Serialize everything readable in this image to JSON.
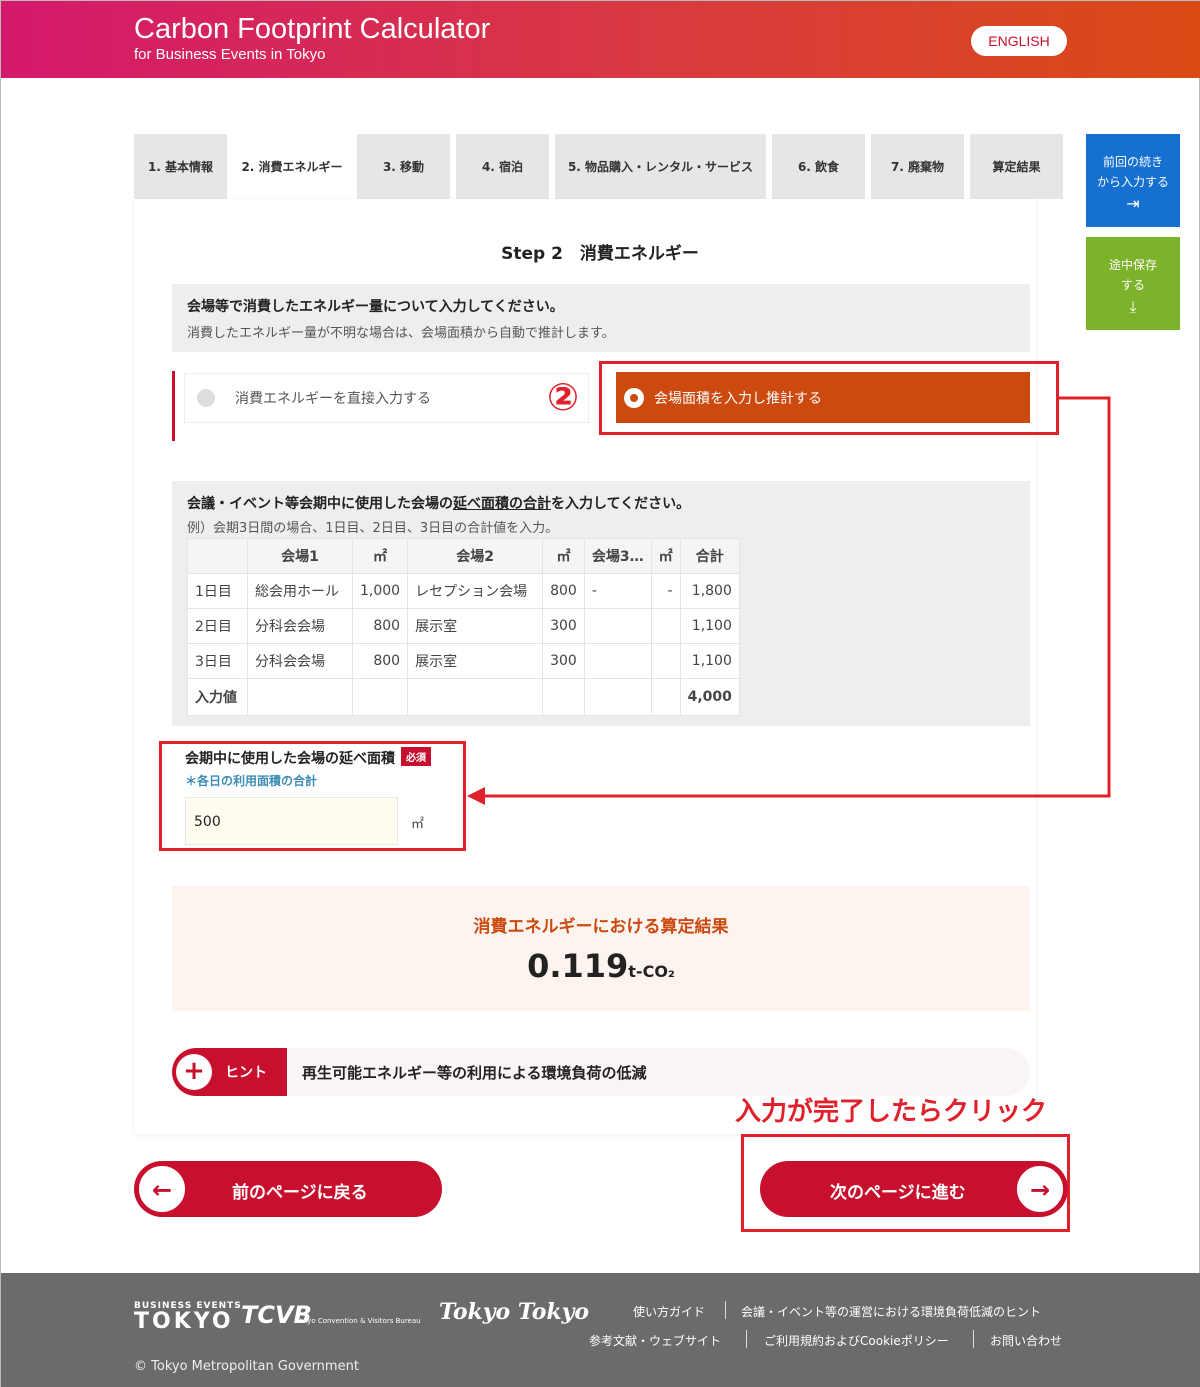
{
  "header": {
    "title": "Carbon Footprint Calculator",
    "subtitle": "for Business Events in Tokyo",
    "lang_button": "ENGLISH"
  },
  "tabs": [
    {
      "label": "1. 基本情報"
    },
    {
      "label": "2. 消費エネルギー",
      "active": true
    },
    {
      "label": "3. 移動"
    },
    {
      "label": "4. 宿泊"
    },
    {
      "label": "5. 物品購入・レンタル・サービス"
    },
    {
      "label": "6. 飲食"
    },
    {
      "label": "7. 廃棄物"
    },
    {
      "label": "算定結果"
    }
  ],
  "side": {
    "resume_label_1": "前回の続き",
    "resume_label_2": "から入力する",
    "save_label_1": "途中保存",
    "save_label_2": "する"
  },
  "step": {
    "title": "Step 2　消費エネルギー",
    "note_line1": "会場等で消費したエネルギー量について入力してください。",
    "note_line2": "消費したエネルギー量が不明な場合は、会場面積から自動で推計します。"
  },
  "options": {
    "direct": "消費エネルギーを直接入力する",
    "estimate": "会場面積を入力し推計する",
    "selected": "estimate",
    "annotation_number": "②"
  },
  "area": {
    "line1_pre": "会議・イベント等会期中に使用した会場の",
    "line1_u": "延べ面積の合計",
    "line1_post": "を入力してください。",
    "line2": "例）会期3日間の場合、1日目、2日目、3日目の合計値を入力。",
    "table": {
      "headers": [
        "",
        "会場1",
        "㎡",
        "会場2",
        "㎡",
        "会場3…",
        "㎡",
        "合計"
      ],
      "rows": [
        [
          "1日目",
          "総会用ホール",
          "1,000",
          "レセプション会場",
          "800",
          "-",
          "-",
          "1,800"
        ],
        [
          "2日目",
          "分科会会場",
          "800",
          "展示室",
          "300",
          "",
          "",
          "1,100"
        ],
        [
          "3日目",
          "分科会会場",
          "800",
          "展示室",
          "300",
          "",
          "",
          "1,100"
        ],
        [
          "入力値",
          "",
          "",
          "",
          "",
          "",
          "",
          "4,000"
        ]
      ]
    }
  },
  "field": {
    "label": "会期中に使用した会場の延べ面積",
    "required": "必須",
    "sub": "＊各日の利用面積の合計",
    "value": "500",
    "unit": "㎡"
  },
  "result": {
    "title": "消費エネルギーにおける算定結果",
    "value": "0.119",
    "unit": "t-CO₂"
  },
  "hint": {
    "tag": "ヒント",
    "text": "再生可能エネルギー等の利用による環境負荷の低減"
  },
  "annotation": "入力が完了したらクリック",
  "nav": {
    "prev": "前のページに戻る",
    "next": "次のページに進む"
  },
  "footer": {
    "logo_be": "BUSINESS EVENTS",
    "logo_tokyo": "TOKYO",
    "logo_tcvb": "TCVB",
    "logo_tcvb_sub": "Tokyo Convention & Visitors Bureau",
    "logo_tt": "Tokyo Tokyo",
    "links": [
      "使い方ガイド",
      "会議・イベント等の運営における環境負荷低減のヒント",
      "参考文献・ウェブサイト",
      "ご利用規約およびCookieポリシー",
      "お問い合わせ"
    ],
    "copyright": "© Tokyo Metropolitan Government"
  },
  "colors": {
    "brand_red": "#c8102e",
    "selected_orange": "#cc4a10",
    "annotation_red": "#e0202a",
    "save_green": "#7db32a",
    "resume_blue": "#1670d0"
  }
}
